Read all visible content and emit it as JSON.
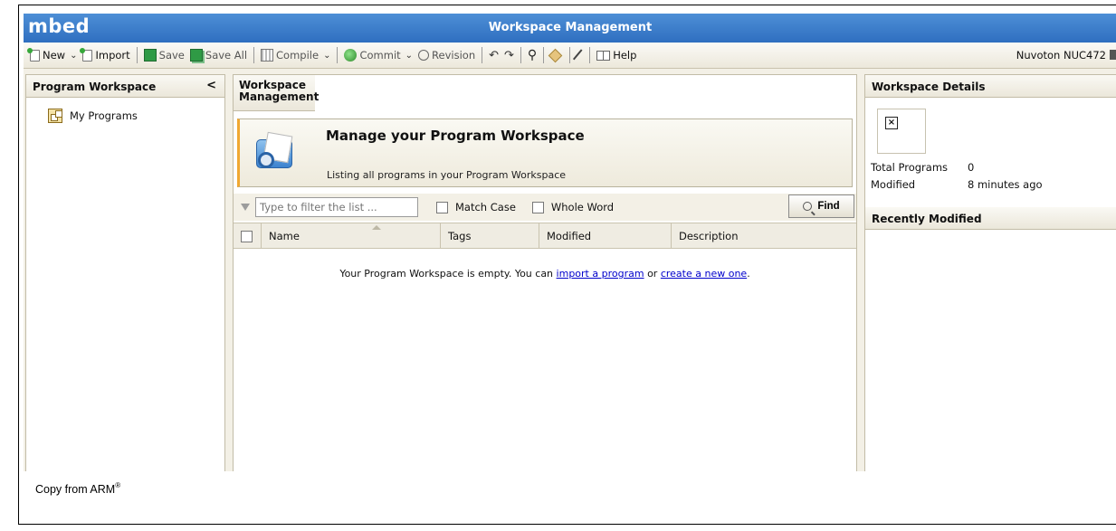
{
  "app": {
    "brand": "mbed",
    "title": "Workspace Management"
  },
  "toolbar": {
    "new": "New",
    "import": "Import",
    "save": "Save",
    "save_all": "Save All",
    "compile": "Compile",
    "commit": "Commit",
    "revision": "Revision",
    "help": "Help",
    "device": "Nuvoton NUC472"
  },
  "left_panel": {
    "title": "Program Workspace",
    "collapse": "<",
    "items": [
      {
        "label": "My Programs"
      }
    ]
  },
  "main": {
    "title": "Workspace Management",
    "banner_title": "Manage your Program Workspace",
    "banner_subtitle": "Listing all programs in your Program Workspace",
    "filter_placeholder": "Type to filter the list ...",
    "match_case": "Match Case",
    "whole_word": "Whole Word",
    "find": "Find",
    "columns": [
      "Name",
      "Tags",
      "Modified",
      "Description"
    ],
    "empty_text": "Your Program Workspace is empty. You can",
    "import_link": "import a program",
    "or_text": "or",
    "create_link": "create a new one",
    "period": "."
  },
  "details": {
    "title": "Workspace Details",
    "avatar_icon": "broken-image-icon",
    "total_programs_label": "Total Programs",
    "total_programs_value": "0",
    "modified_label": "Modified",
    "modified_value": "8 minutes ago",
    "recent_title": "Recently Modified"
  },
  "caption": {
    "text": "Copy from ARM",
    "mark": "®"
  }
}
